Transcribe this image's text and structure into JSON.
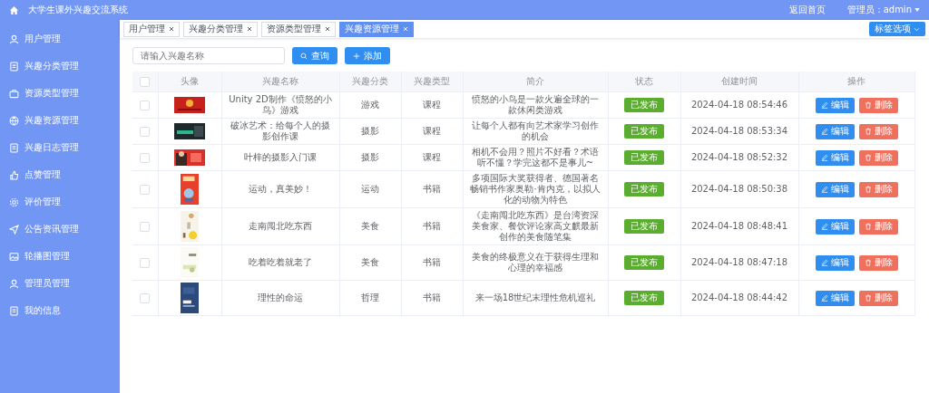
{
  "header": {
    "title": "大学生课外兴趣交流系统",
    "home_link": "返回首页",
    "user": "管理员：admin"
  },
  "sidebar": {
    "items": [
      {
        "label": "用户管理"
      },
      {
        "label": "兴趣分类管理"
      },
      {
        "label": "资源类型管理"
      },
      {
        "label": "兴趣资源管理"
      },
      {
        "label": "兴趣日志管理"
      },
      {
        "label": "点赞管理"
      },
      {
        "label": "评价管理"
      },
      {
        "label": "公告资讯管理"
      },
      {
        "label": "轮播图管理"
      },
      {
        "label": "管理员管理"
      },
      {
        "label": "我的信息"
      }
    ]
  },
  "tabs": [
    {
      "label": "用户管理",
      "selected": false
    },
    {
      "label": "兴趣分类管理",
      "selected": false
    },
    {
      "label": "资源类型管理",
      "selected": false
    },
    {
      "label": "兴趣资源管理",
      "selected": true
    }
  ],
  "tag_options": "标签选项",
  "search": {
    "placeholder": "请输入兴趣名称",
    "button": "查询",
    "add_button": "添加"
  },
  "table": {
    "select_all_checked": false,
    "columns": [
      "头像",
      "兴趣名称",
      "兴趣分类",
      "兴趣类型",
      "简介",
      "状态",
      "创建时间",
      "操作"
    ],
    "rows": [
      {
        "checked": false,
        "name": "Unity 2D制作《愤怒的小鸟》游戏",
        "category": "游戏",
        "type": "课程",
        "intro": "愤怒的小鸟是一款火遍全球的一款休闲类游戏",
        "status": "已发布",
        "created": "2024-04-18 08:54:46",
        "actions": [
          {
            "kind": "edit",
            "label": "编辑"
          },
          {
            "kind": "delete",
            "label": "删除"
          }
        ]
      },
      {
        "checked": false,
        "name": "破冰艺术：给每个人的摄影创作课",
        "category": "摄影",
        "type": "课程",
        "intro": "让每个人都有向艺术家学习创作的机会",
        "status": "已发布",
        "created": "2024-04-18 08:53:34",
        "actions": [
          {
            "kind": "edit",
            "label": "编辑"
          },
          {
            "kind": "delete",
            "label": "删除"
          }
        ]
      },
      {
        "checked": false,
        "name": "叶梓的摄影入门课",
        "category": "摄影",
        "type": "课程",
        "intro": "相机不会用？照片不好看？术语听不懂？学完这都不是事儿~",
        "status": "已发布",
        "created": "2024-04-18 08:52:32",
        "actions": [
          {
            "kind": "edit",
            "label": "编辑"
          },
          {
            "kind": "delete",
            "label": "删除"
          }
        ]
      },
      {
        "checked": false,
        "name": "运动，真美妙！",
        "category": "运动",
        "type": "书籍",
        "intro": "多项国际大奖获得者、德国著名畅销书作家奥勒·肯内克，以拟人化的动物为特色",
        "status": "已发布",
        "created": "2024-04-18 08:50:38",
        "actions": [
          {
            "kind": "edit",
            "label": "编辑"
          },
          {
            "kind": "delete",
            "label": "删除"
          }
        ]
      },
      {
        "checked": false,
        "name": "走南闯北吃东西",
        "category": "美食",
        "type": "书籍",
        "intro": "《走南闯北吃东西》是台湾资深美食家、餐饮评论家高文麒最新创作的美食随笔集",
        "status": "已发布",
        "created": "2024-04-18 08:48:41",
        "actions": [
          {
            "kind": "edit",
            "label": "编辑"
          },
          {
            "kind": "delete",
            "label": "删除"
          }
        ]
      },
      {
        "checked": false,
        "name": "吃着吃着就老了",
        "category": "美食",
        "type": "书籍",
        "intro": "美食的终极意义在于获得生理和心理的幸福感",
        "status": "已发布",
        "created": "2024-04-18 08:47:18",
        "actions": [
          {
            "kind": "edit",
            "label": "编辑"
          },
          {
            "kind": "delete",
            "label": "删除"
          }
        ]
      },
      {
        "checked": false,
        "name": "理性的命运",
        "category": "哲理",
        "type": "书籍",
        "intro": "来一场18世纪末理性危机巡礼",
        "status": "已发布",
        "created": "2024-04-18 08:44:42",
        "actions": [
          {
            "kind": "edit",
            "label": "编辑"
          },
          {
            "kind": "delete",
            "label": "删除"
          }
        ]
      }
    ]
  }
}
